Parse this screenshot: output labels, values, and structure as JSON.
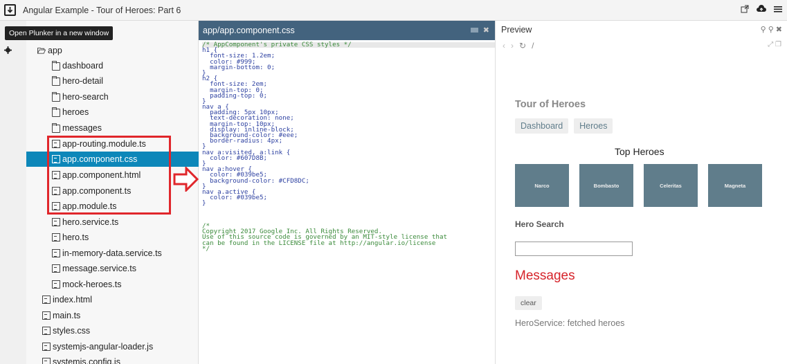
{
  "topbar": {
    "title": "Angular Example - Tour of Heroes: Part 6",
    "icons": [
      "download-icon",
      "external-link-icon",
      "cloud-icon",
      "menu-icon"
    ]
  },
  "tooltip": {
    "text": "Open Plunker in a new window"
  },
  "tree": {
    "root": "app",
    "folders": [
      "dashboard",
      "hero-detail",
      "hero-search",
      "heroes",
      "messages"
    ],
    "app_files": [
      "app-routing.module.ts",
      "app.component.css",
      "app.component.html",
      "app.component.ts",
      "app.module.ts",
      "hero.service.ts",
      "hero.ts",
      "in-memory-data.service.ts",
      "message.service.ts",
      "mock-heroes.ts"
    ],
    "root_files": [
      "index.html",
      "main.ts",
      "styles.css",
      "systemjs-angular-loader.js",
      "systemjs.config.js"
    ],
    "selected": "app.component.css"
  },
  "editor": {
    "tab_title": "app/app.component.css",
    "code_lines": [
      {
        "t": "c",
        "v": "/* AppComponent's private CSS styles */"
      },
      {
        "t": "n",
        "v": "h1 {"
      },
      {
        "t": "n",
        "v": "  font-size: 1.2em;"
      },
      {
        "t": "n",
        "v": "  color: #999;"
      },
      {
        "t": "n",
        "v": "  margin-bottom: 0;"
      },
      {
        "t": "n",
        "v": "}"
      },
      {
        "t": "n",
        "v": "h2 {"
      },
      {
        "t": "n",
        "v": "  font-size: 2em;"
      },
      {
        "t": "n",
        "v": "  margin-top: 0;"
      },
      {
        "t": "n",
        "v": "  padding-top: 0;"
      },
      {
        "t": "n",
        "v": "}"
      },
      {
        "t": "n",
        "v": "nav a {"
      },
      {
        "t": "n",
        "v": "  padding: 5px 10px;"
      },
      {
        "t": "n",
        "v": "  text-decoration: none;"
      },
      {
        "t": "n",
        "v": "  margin-top: 10px;"
      },
      {
        "t": "n",
        "v": "  display: inline-block;"
      },
      {
        "t": "n",
        "v": "  background-color: #eee;"
      },
      {
        "t": "n",
        "v": "  border-radius: 4px;"
      },
      {
        "t": "n",
        "v": "}"
      },
      {
        "t": "n",
        "v": "nav a:visited, a:link {"
      },
      {
        "t": "n",
        "v": "  color: #607D8B;"
      },
      {
        "t": "n",
        "v": "}"
      },
      {
        "t": "n",
        "v": "nav a:hover {"
      },
      {
        "t": "n",
        "v": "  color: #039be5;"
      },
      {
        "t": "n",
        "v": "  background-color: #CFD8DC;"
      },
      {
        "t": "n",
        "v": "}"
      },
      {
        "t": "n",
        "v": "nav a.active {"
      },
      {
        "t": "n",
        "v": "  color: #039be5;"
      },
      {
        "t": "n",
        "v": "}"
      },
      {
        "t": "n",
        "v": ""
      },
      {
        "t": "n",
        "v": ""
      },
      {
        "t": "n",
        "v": ""
      },
      {
        "t": "c",
        "v": "/*"
      },
      {
        "t": "c",
        "v": "Copyright 2017 Google Inc. All Rights Reserved."
      },
      {
        "t": "c",
        "v": "Use of this source code is governed by an MIT-style license that"
      },
      {
        "t": "c",
        "v": "can be found in the LICENSE file at http://angular.io/license"
      },
      {
        "t": "c",
        "v": "*/"
      }
    ]
  },
  "preview": {
    "label": "Preview",
    "path": "/",
    "app_title": "Tour of Heroes",
    "nav_links": [
      "Dashboard",
      "Heroes"
    ],
    "top_heroes_title": "Top Heroes",
    "heroes": [
      "Narco",
      "Bombasto",
      "Celeritas",
      "Magneta"
    ],
    "hero_search_title": "Hero Search",
    "messages_title": "Messages",
    "clear_label": "clear",
    "message_line": "HeroService: fetched heroes"
  },
  "colors": {
    "selection": "#0d87b9",
    "editor_tab": "#43637e",
    "hero_tile": "#607d8b",
    "annotation_red": "#e0262b",
    "messages_red": "#d6232a"
  }
}
